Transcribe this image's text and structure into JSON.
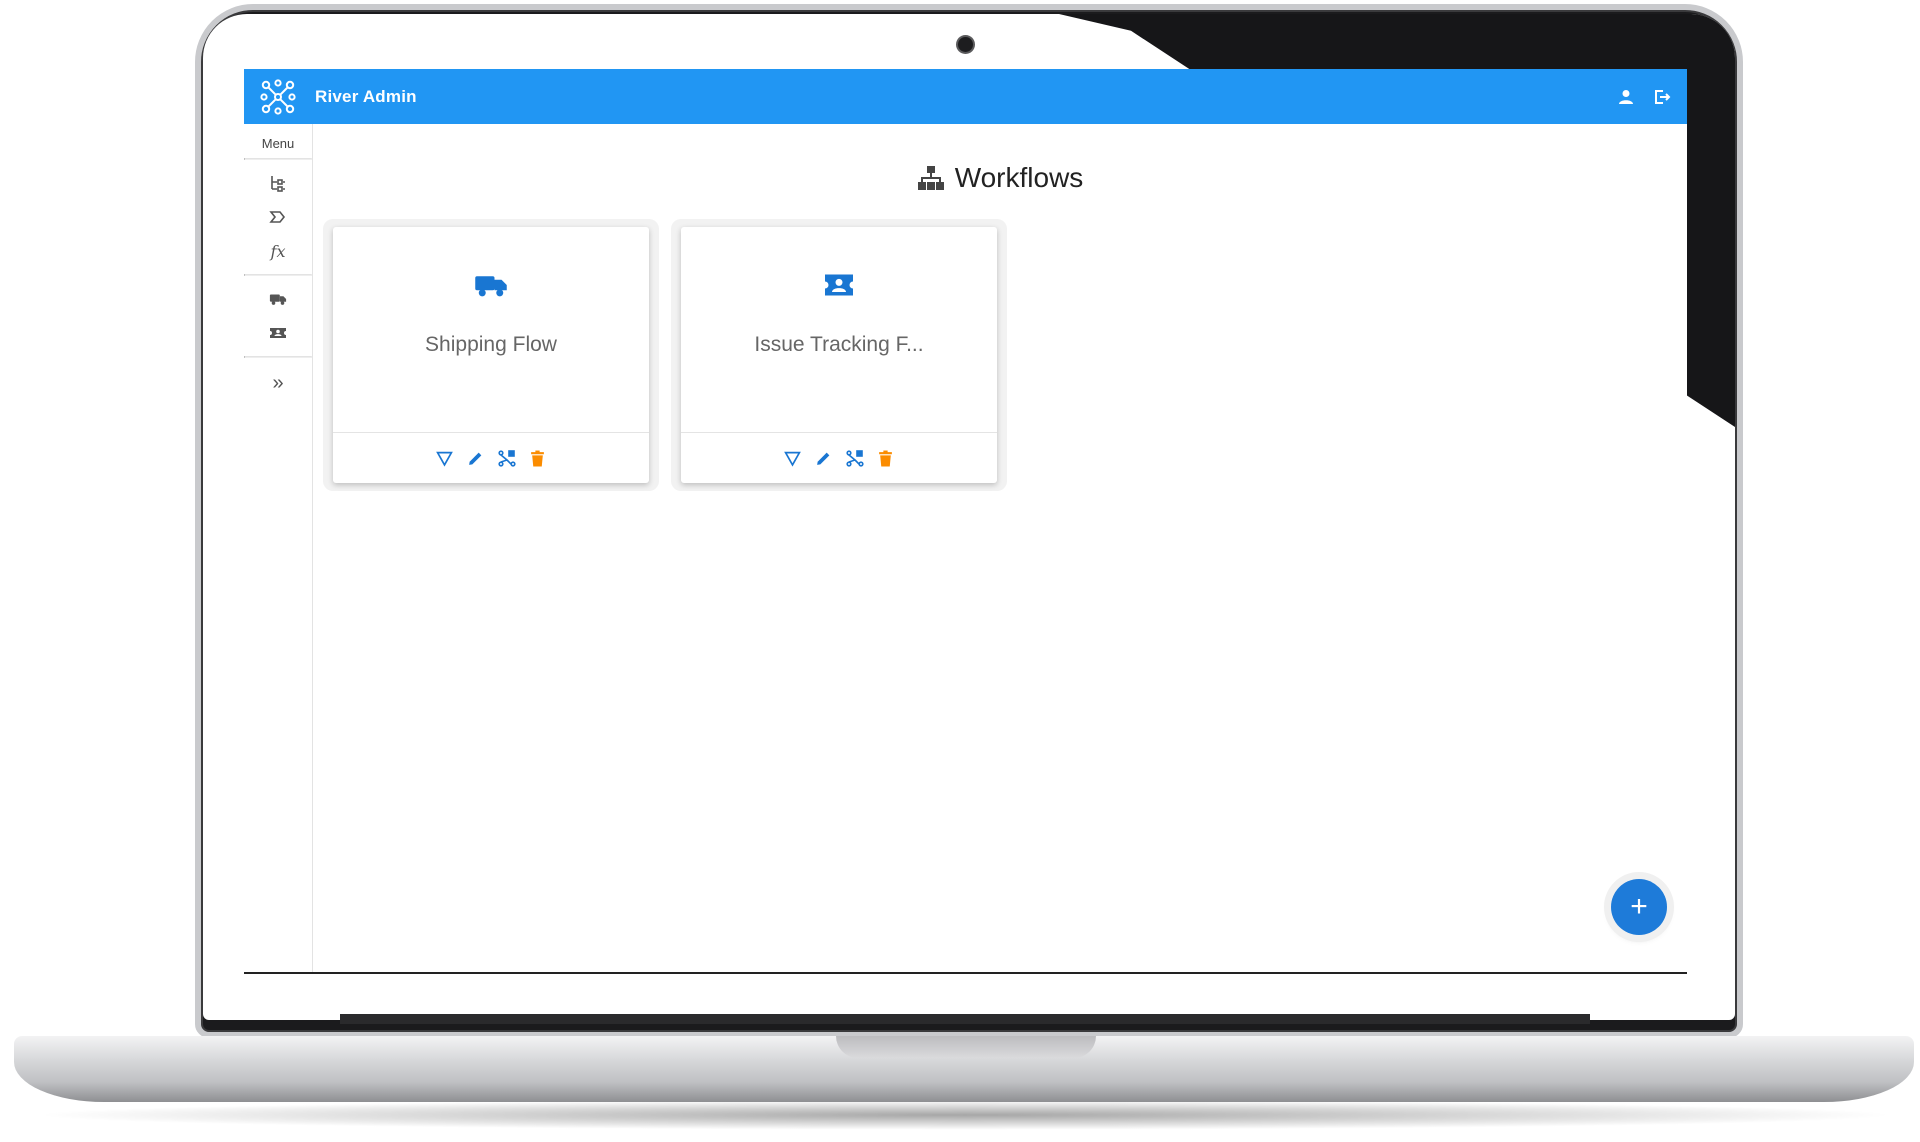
{
  "app": {
    "title": "River Admin",
    "accent_color": "#2196f3",
    "header_icons": [
      "person-icon",
      "logout-icon"
    ]
  },
  "sidebar": {
    "menu_label": "Menu",
    "group1": [
      {
        "icon": "tree-structure-icon"
      },
      {
        "icon": "state-icon"
      },
      {
        "icon": "function-icon",
        "text": "fx"
      }
    ],
    "group2": [
      {
        "icon": "truck-icon"
      },
      {
        "icon": "ticket-icon"
      }
    ],
    "expand_icon": "double-chevron-right-icon",
    "expand_text": "»"
  },
  "main": {
    "title": "Workflows",
    "title_icon": "sitemap-icon",
    "cards": [
      {
        "title": "Shipping Flow",
        "icon": "truck-icon"
      },
      {
        "title": "Issue Tracking F...",
        "icon": "ticket-icon"
      }
    ],
    "card_actions": [
      {
        "icon": "funnel-icon",
        "color": "#1976d2"
      },
      {
        "icon": "pencil-icon",
        "color": "#1976d2"
      },
      {
        "icon": "transitions-icon",
        "color": "#1976d2"
      },
      {
        "icon": "trash-icon",
        "color": "#fb8c00"
      }
    ],
    "fab_label": "+"
  }
}
